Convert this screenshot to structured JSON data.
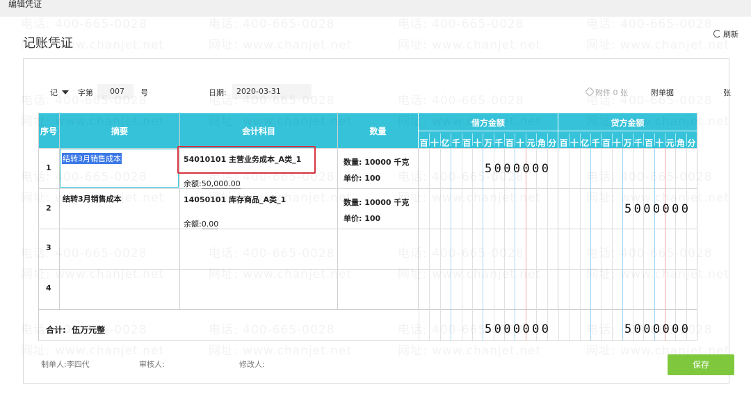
{
  "window": {
    "title": "编辑凭证"
  },
  "page": {
    "title": "记账凭证",
    "refresh_label": "刷新"
  },
  "voucher": {
    "word": "记",
    "word_no_label": "字第",
    "number": "007",
    "number_suffix": "号",
    "date_label": "日期:",
    "date": "2020-03-31",
    "attachment_label": "附件",
    "attachment_count": "0",
    "attachment_unit": "张",
    "attach_docs_label": "附单据"
  },
  "table": {
    "headers": {
      "seq": "序号",
      "summary": "摘要",
      "account": "会计科目",
      "qty": "数量",
      "debit": "借方金额",
      "credit": "贷方金额"
    },
    "digit_units": [
      "百",
      "十",
      "亿",
      "千",
      "百",
      "十",
      "万",
      "千",
      "百",
      "十",
      "元",
      "角",
      "分"
    ],
    "balance_label": "余额:",
    "qty_label": "数量:",
    "price_label": "单价:",
    "rows": [
      {
        "seq": "1",
        "summary": "结转3月销售成本",
        "account": "54010101 主营业务成本_A类_1",
        "balance": "50,000.00",
        "qty": "10000 千克",
        "price": "100",
        "debit": "5000000",
        "credit": ""
      },
      {
        "seq": "2",
        "summary": "结转3月销售成本",
        "account": "14050101 库存商品_A类_1",
        "balance": "0.00",
        "qty": "10000 千克",
        "price": "100",
        "debit": "",
        "credit": "5000000"
      },
      {
        "seq": "3",
        "summary": "",
        "account": "",
        "balance": "",
        "qty": "",
        "price": "",
        "debit": "",
        "credit": ""
      },
      {
        "seq": "4",
        "summary": "",
        "account": "",
        "balance": "",
        "qty": "",
        "price": "",
        "debit": "",
        "credit": ""
      }
    ],
    "total_label": "合计:",
    "total_text": "伍万元整",
    "total_debit": "5000000",
    "total_credit": "5000000"
  },
  "footer": {
    "maker_label": "制单人:",
    "maker": "李四代",
    "reviewer_label": "审核人:",
    "modifier_label": "修改人:",
    "save_label": "保存"
  },
  "watermark": {
    "phone": "电话: 400-665-0028",
    "site": "网址: www.chanjet.net"
  },
  "colors": {
    "header": "#36c3da",
    "save": "#7fc83e",
    "highlight": "#d9333f"
  }
}
